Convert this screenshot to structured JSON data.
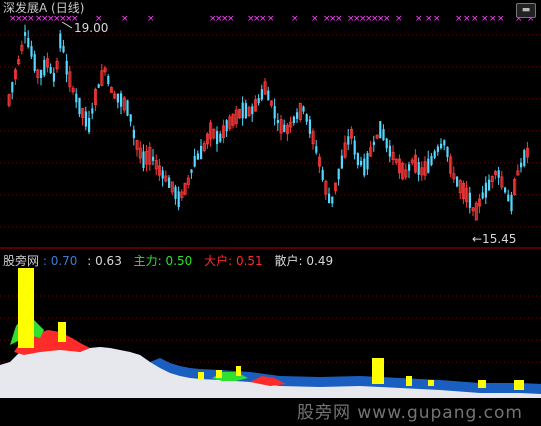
{
  "title": "深发展A (日线)",
  "menu_icon": "menu-icon",
  "price_high_label": "19.00",
  "price_low_label": "←15.45",
  "price_high_value": 19.0,
  "price_low_value": 15.45,
  "indicator": {
    "name": "股旁网",
    "v1": ": 0.70",
    "v2": ": 0.63",
    "main_label": "主力",
    "main_value": ": 0.50",
    "big_label": "大户",
    "big_value": ": 0.51",
    "retail_label": "散户",
    "retail_value": ": 0.49"
  },
  "watermark": "股旁网  www.gupang.com",
  "colors": {
    "up": "#ff3a3a",
    "down": "#54d8ff",
    "signal": "#ff44ff",
    "separator": "#b00000",
    "retail": "#e6e8ee",
    "main_force": "#1a5fbf",
    "big_holder": "#ff2a2a",
    "strong": "#2fe02f",
    "extreme": "#ffff00"
  }
}
